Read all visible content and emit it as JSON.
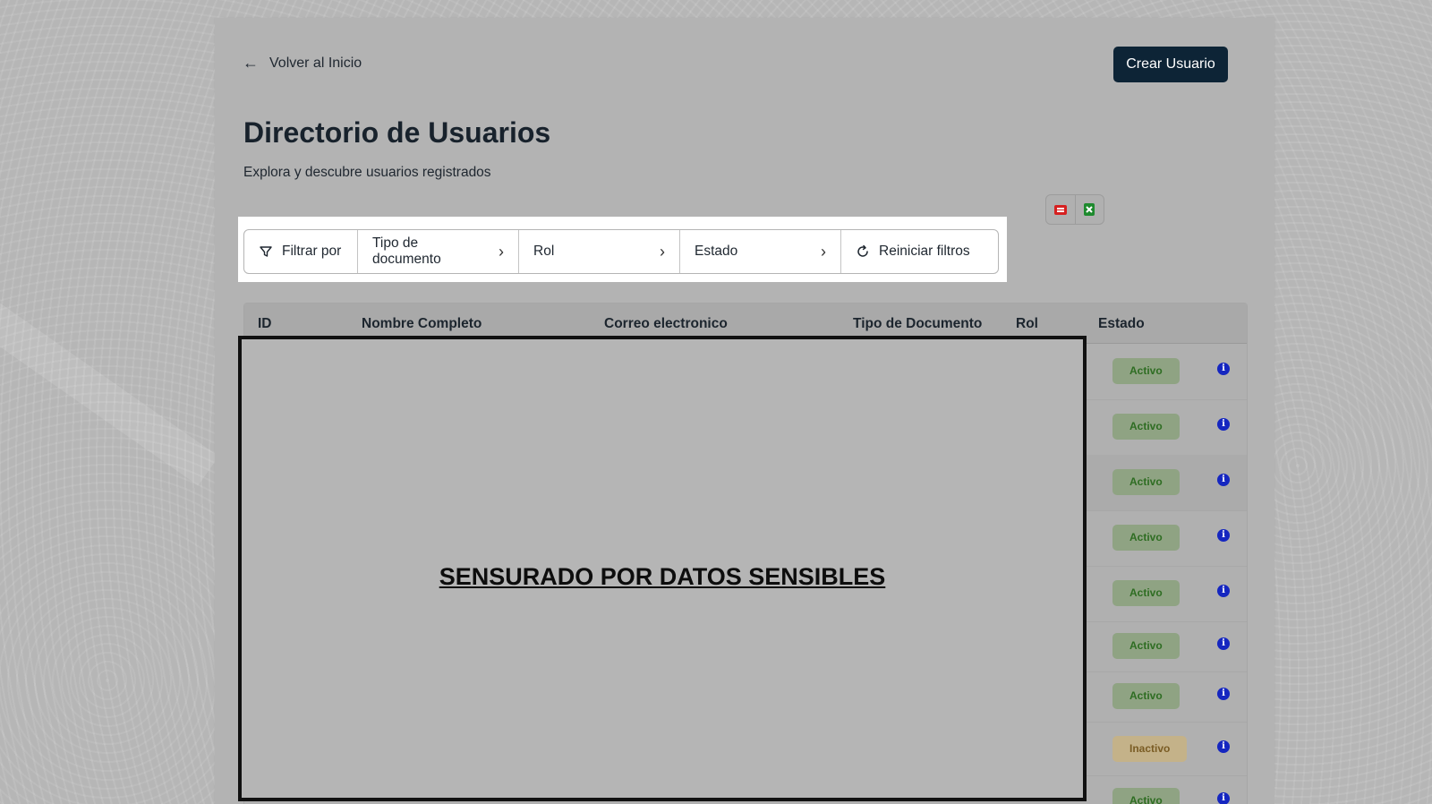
{
  "header": {
    "back_label": "Volver al Inicio",
    "create_button": "Crear Usuario",
    "title": "Directorio de Usuarios",
    "subtitle": "Explora y descubre usuarios registrados"
  },
  "export": {
    "pdf_icon": "pdf-file-icon",
    "excel_icon": "excel-file-icon",
    "pdf_color": "#d62020",
    "excel_color": "#1e8a2e"
  },
  "filters": {
    "filter_by": "Filtrar por",
    "document_type": "Tipo de documento",
    "role": "Rol",
    "status": "Estado",
    "reset": "Reiniciar filtros"
  },
  "table": {
    "columns": [
      "ID",
      "Nombre Completo",
      "Correo electronico",
      "Tipo de Documento",
      "Rol",
      "Estado"
    ],
    "rows": [
      {
        "status": "Activo"
      },
      {
        "status": "Activo"
      },
      {
        "status": "Activo"
      },
      {
        "status": "Activo"
      },
      {
        "status": "Activo"
      },
      {
        "status": "Activo"
      },
      {
        "status": "Activo"
      },
      {
        "status": "Inactivo"
      },
      {
        "status": "Activo"
      }
    ]
  },
  "redaction": {
    "label": "SENSURADO POR DATOS SENSIBLES"
  },
  "colors": {
    "primary_button": "#0d2436",
    "active_badge_bg": "#8fa383",
    "active_badge_text": "#2e6d22",
    "inactive_badge_bg": "#c4b289",
    "inactive_badge_text": "#7a5c24",
    "info_icon": "#1526c0"
  }
}
